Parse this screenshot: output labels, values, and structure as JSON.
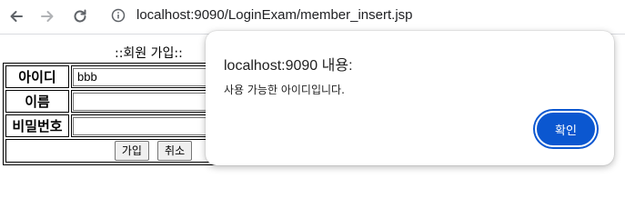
{
  "browser": {
    "url": "localhost:9090/LoginExam/member_insert.jsp"
  },
  "form": {
    "title": "::회원 가입::",
    "rows": [
      {
        "label": "아이디",
        "value": "bbb"
      },
      {
        "label": "이름",
        "value": ""
      },
      {
        "label": "비밀번호",
        "value": ""
      }
    ],
    "submit_label": "가입",
    "cancel_label": "취소"
  },
  "dialog": {
    "title": "localhost:9090 내용:",
    "message": "사용 가능한 아이디입니다.",
    "ok_label": "확인"
  },
  "colors": {
    "accent": "#0b57d0",
    "toolbar_icon": "#5f6368"
  }
}
